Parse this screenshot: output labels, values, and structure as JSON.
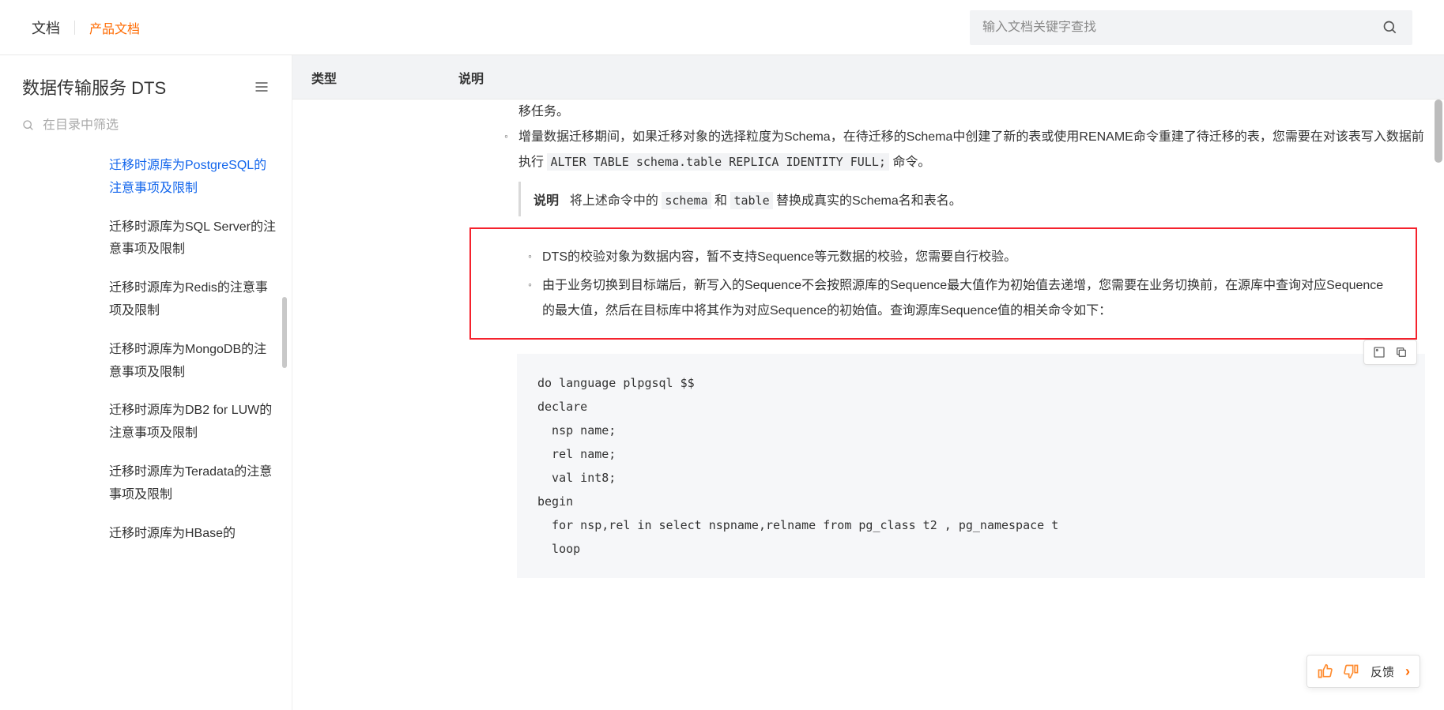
{
  "header": {
    "title": "文档",
    "subtitle": "产品文档"
  },
  "search": {
    "placeholder": "输入文档关键字查找"
  },
  "sidebar": {
    "product": "数据传输服务 DTS",
    "filter_placeholder": "在目录中筛选",
    "items": [
      {
        "label": "迁移时源库为PostgreSQL的注意事项及限制",
        "active": true
      },
      {
        "label": "迁移时源库为SQL Server的注意事项及限制",
        "active": false
      },
      {
        "label": "迁移时源库为Redis的注意事项及限制",
        "active": false
      },
      {
        "label": "迁移时源库为MongoDB的注意事项及限制",
        "active": false
      },
      {
        "label": "迁移时源库为DB2 for LUW的注意事项及限制",
        "active": false
      },
      {
        "label": "迁移时源库为Teradata的注意事项及限制",
        "active": false
      },
      {
        "label": "迁移时源库为HBase的",
        "active": false
      }
    ]
  },
  "tableHead": {
    "col1": "类型",
    "col2": "说明"
  },
  "body": {
    "trail": "移任务。",
    "p1_a": "增量数据迁移期间，如果迁移对象的选择粒度为Schema，在待迁移的Schema中创建了新的表或使用RENAME命令重建了待迁移的表，您需要在对该表写入数据前执行 ",
    "p1_code": "ALTER TABLE schema.table REPLICA IDENTITY FULL;",
    "p1_b": " 命令。",
    "note_label": "说明",
    "note_a": "将上述命令中的 ",
    "note_c1": "schema",
    "note_b": " 和 ",
    "note_c2": "table",
    "note_c": " 替换成真实的Schema名和表名。",
    "red1": "DTS的校验对象为数据内容，暂不支持Sequence等元数据的校验，您需要自行校验。",
    "red2": "由于业务切换到目标端后，新写入的Sequence不会按照源库的Sequence最大值作为初始值去递增，您需要在业务切换前，在源库中查询对应Sequence的最大值，然后在目标库中将其作为对应Sequence的初始值。查询源库Sequence值的相关命令如下：",
    "code": "do language plpgsql $$\ndeclare\n  nsp name;\n  rel name;\n  val int8;\nbegin\n  for nsp,rel in select nspname,relname from pg_class t2 , pg_namespace t\n  loop"
  },
  "feedback": {
    "label": "反馈"
  }
}
